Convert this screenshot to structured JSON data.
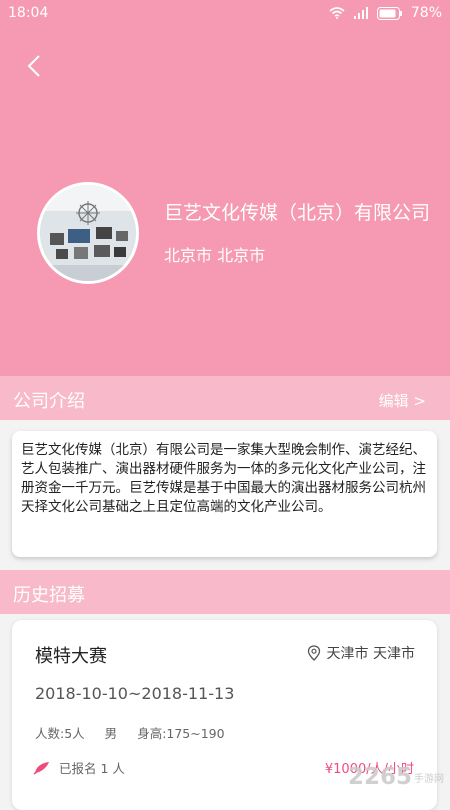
{
  "status": {
    "time": "18:04",
    "battery": "78%"
  },
  "header": {
    "company_name": "巨艺文化传媒（北京）有限公司",
    "location": "北京市 北京市"
  },
  "intro_section": {
    "title": "公司介绍",
    "edit_label": "编辑 >",
    "text": "巨艺文化传媒（北京）有限公司是一家集大型晚会制作、演艺经纪、艺人包装推广、演出器材硬件服务为一体的多元化文化产业公司，注册资金一千万元。巨艺传媒是基于中国最大的演出器材服务公司杭州天择文化公司基础之上且定位高端的文化产业公司。"
  },
  "history_section": {
    "title": "历史招募"
  },
  "recruit": {
    "title": "模特大赛",
    "location": "天津市 天津市",
    "date_range": "2018-10-10~2018-11-13",
    "count": "人数:5人",
    "gender": "男",
    "height": "身高:175~190",
    "signed": "已报名 1 人",
    "price": "¥1000/人/小时"
  },
  "watermark": {
    "brand": "2265",
    "sub": "手游网"
  },
  "colors": {
    "header": "#f59ab2",
    "section": "#f8b9ca",
    "accent": "#ef4b7b"
  }
}
